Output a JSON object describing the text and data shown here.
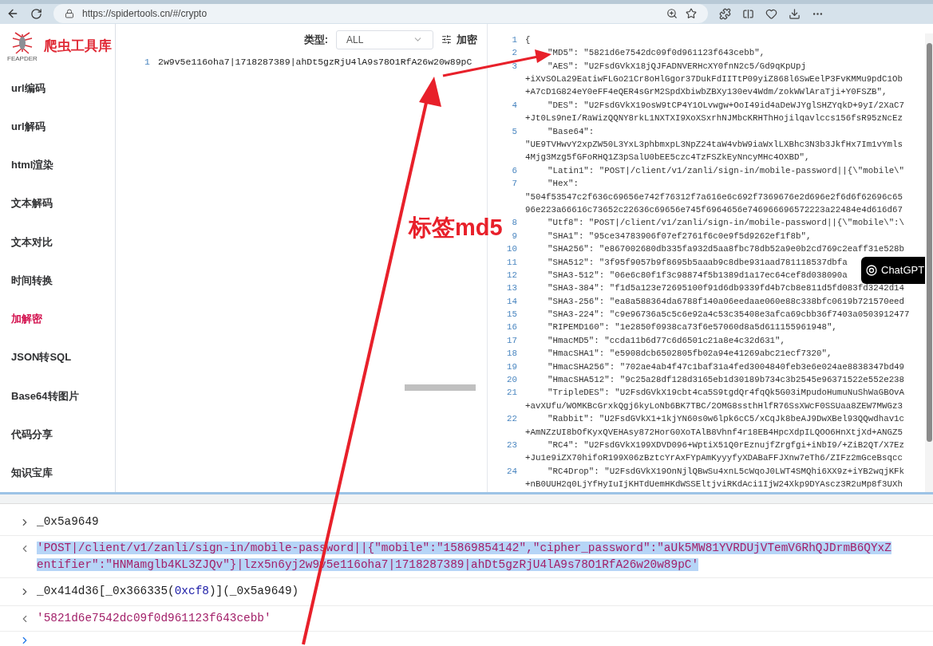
{
  "browser": {
    "url": "https://spidertools.cn/#/crypto"
  },
  "sidebar": {
    "logo_caption": "FEAPDER",
    "title": "爬虫工具库",
    "items": [
      {
        "label": "url编码",
        "selected": false
      },
      {
        "label": "url解码",
        "selected": false
      },
      {
        "label": "html渲染",
        "selected": false
      },
      {
        "label": "文本解码",
        "selected": false
      },
      {
        "label": "文本对比",
        "selected": false
      },
      {
        "label": "时间转换",
        "selected": false
      },
      {
        "label": "加解密",
        "selected": true
      },
      {
        "label": "JSON转SQL",
        "selected": false
      },
      {
        "label": "Base64转图片",
        "selected": false
      },
      {
        "label": "代码分享",
        "selected": false
      },
      {
        "label": "知识宝库",
        "selected": false
      }
    ]
  },
  "editor": {
    "type_label": "类型:",
    "type_value": "ALL",
    "action": "加密",
    "lines": [
      {
        "number": "1",
        "text": "2w9v5e116oha7|1718287389|ahDt5gzRjU4lA9s78O1RfA26w20w89pC"
      }
    ]
  },
  "output": {
    "lines": [
      {
        "kind": "brace",
        "number": "1",
        "text": "{"
      },
      {
        "kind": "entry",
        "number": "2",
        "text": "\"MD5\": \"5821d6e7542dc09f0d961123f643cebb\","
      },
      {
        "kind": "entry",
        "number": "3",
        "text": "\"AES\": \"U2FsdGVkX18jQJFADNVERHcXY0fnN2c5/Gd9qKpUpj"
      },
      {
        "kind": "wrap",
        "text": "+iXvSOLa29EatiwFLGo21Cr8oHlGgor37DukFdIITtP09yiZ868l6SwEelP3FvKMMu9pdC1Ob"
      },
      {
        "kind": "wrap",
        "text": "+A7cD1G824eY0eFF4eQER4sGrM2SpdXbiwbZBXy130ev4Wdm/zokWWlAraTji+Y0FSZB\","
      },
      {
        "kind": "entry",
        "number": "4",
        "text": "\"DES\": \"U2FsdGVkX19osW9tCP4Y1OLvwgw+OoI49id4aDeWJYglSHZYqkD+9yI/2XaC7"
      },
      {
        "kind": "wrap",
        "text": "+Jt0Ls9neI/RaWizQQNY8rkL1NXTXI9XoXSxrhNJMbcKRHThHojilqavlccs156fsR95zNcEz"
      },
      {
        "kind": "entry",
        "number": "5",
        "text": "\"Base64\":"
      },
      {
        "kind": "wrap",
        "text": "\"UE9TVHwvY2xpZW50L3YxL3phbmxpL3NpZ24taW4vbW9iaWxlLXBhc3N3b3JkfHx7Im1vYmls"
      },
      {
        "kind": "wrap",
        "text": "4Mjg3Mzg5fGFoRHQ1Z3pSalU0bEE5czc4TzFSZkEyNncyMHc4OXBD\","
      },
      {
        "kind": "entry",
        "number": "6",
        "text": "\"Latin1\": \"POST|/client/v1/zanli/sign-in/mobile-password||{\\\"mobile\\\""
      },
      {
        "kind": "entry",
        "number": "7",
        "text": "\"Hex\":"
      },
      {
        "kind": "wrap",
        "text": "\"504f53547c2f636c69656e742f76312f7a616e6c692f7369676e2d696e2f6d6f62696c65"
      },
      {
        "kind": "wrap",
        "text": "96e223a66616c73652c22636c69656e745f6964656e746966696572223a22484e4d616d67"
      },
      {
        "kind": "entry",
        "number": "8",
        "text": "\"Utf8\": \"POST|/client/v1/zanli/sign-in/mobile-password||{\\\"mobile\\\":\\"
      },
      {
        "kind": "entry",
        "number": "9",
        "text": "\"SHA1\": \"95ce34783906f07ef2761f6c0e9f5d9262ef1f8b\","
      },
      {
        "kind": "entry",
        "number": "10",
        "text": "\"SHA256\": \"e867002680db335fa932d5aa8fbc78db52a9e0b2cd769c2eaff31e528b"
      },
      {
        "kind": "entry",
        "number": "11",
        "text": "\"SHA512\": \"3f95f9057b9f8695b5aaab9c8dbe931aad781118537dbfa"
      },
      {
        "kind": "entry",
        "number": "12",
        "text": "\"SHA3-512\": \"06e6c80f1f3c98874f5b1389d1a17ec64cef8d038090a"
      },
      {
        "kind": "entry",
        "number": "13",
        "text": "\"SHA3-384\": \"f1d5a123e72695100f91d6db9339fd4b7cb8e811d5fd083fd3242d14"
      },
      {
        "kind": "entry",
        "number": "14",
        "text": "\"SHA3-256\": \"ea8a588364da6788f140a06eedaae060e88c338bfc0619b721570eed"
      },
      {
        "kind": "entry",
        "number": "15",
        "text": "\"SHA3-224\": \"c9e96736a5c5c6e92a4c53c35408e3afca69cbb36f7403a0503912477"
      },
      {
        "kind": "entry",
        "number": "16",
        "text": "\"RIPEMD160\": \"1e2850f0938ca73f6e57060d8a5d611155961948\","
      },
      {
        "kind": "entry",
        "number": "17",
        "text": "\"HmacMD5\": \"ccda11b6d77c6d6501c21a8e4c32d631\","
      },
      {
        "kind": "entry",
        "number": "18",
        "text": "\"HmacSHA1\": \"e5908dcb6502805fb02a94e41269abc21ecf7320\","
      },
      {
        "kind": "entry",
        "number": "19",
        "text": "\"HmacSHA256\": \"702ae4ab4f47c1baf31a4fed3004840feb3e6e024ae8838347bd49"
      },
      {
        "kind": "entry",
        "number": "20",
        "text": "\"HmacSHA512\": \"9c25a28df128d3165eb1d30189b734c3b2545e96371522e552e238"
      },
      {
        "kind": "entry",
        "number": "21",
        "text": "\"TripleDES\": \"U2FsdGVkX19cbt4ca5S9tgdQr4fqQk5G03iMpudoHumuNuShWaGBOvA"
      },
      {
        "kind": "wrap",
        "text": "+avXUfu/WOMKBcGrxkQgj6kyLoNb6BK7TBC/2OMG8ssthHlfR76SsXWcF0SSUaa8ZEW7MWGz3"
      },
      {
        "kind": "entry",
        "number": "22",
        "text": "\"Rabbit\": \"U2FsdGVkX1+1kjYN60s0w6lpk6cC5/xCqJk8beAJ9DwXBel93QQwdhav1c"
      },
      {
        "kind": "wrap",
        "text": "+AmNZzUI8bOfKyxQVEHAsy872HorG0XoTAlB8Vhnf4r18EB4HpcXdpILQOO6HnXtjXd+ANGZ5"
      },
      {
        "kind": "entry",
        "number": "23",
        "text": "\"RC4\": \"U2FsdGVkX199XDVD096+WptiX51Q0rEznujfZrgfgi+iNbI9/+ZiB2QT/X7Ez"
      },
      {
        "kind": "wrap",
        "text": "+Ju1e9iZX70hifoR199X06zBztcYrAxFYpAmKyyyfyXDABaFFJXnw7eTh6/ZIFz2mGceBsqcc"
      },
      {
        "kind": "entry",
        "number": "24",
        "text": "\"RC4Drop\": \"U2FsdGVkX19OnNjlQBwSu4xnL5cWqoJ0LWT4SMQhi6XX9z+iYB2wqjKFk"
      },
      {
        "kind": "wrap",
        "text": "+nB0UUH2q0LjYfHyIuIjKHTdUemHKdWSSEltjviRKdAci1IjW24Xkp9DYAscz3R2uMp8f3UXh"
      }
    ]
  },
  "chatgpt_badge": {
    "label": "ChatGPT"
  },
  "console": {
    "entries": [
      {
        "kind": "input",
        "segments": [
          {
            "kind": "plain",
            "text": "_0x5a9649"
          }
        ]
      },
      {
        "kind": "output",
        "selected": true,
        "lines": [
          "'POST|/client/v1/zanli/sign-in/mobile-password||{\"mobile\":\"15869854142\",\"cipher_password\":\"aUk5MW81YVRDUjVTemV6RhQJDrmB6QYxZ",
          "entifier\":\"HNMamglb4KL3ZJQv\"}|lzx5n6yj2w9v5e116oha7|1718287389|ahDt5gzRjU4lA9s78O1RfA26w20w89pC'"
        ]
      },
      {
        "kind": "input",
        "segments": [
          {
            "kind": "plain",
            "text": "_0x414d36[_0x366335("
          },
          {
            "kind": "number",
            "text": "0xcf8"
          },
          {
            "kind": "plain",
            "text": ")](_0x5a9649)"
          }
        ]
      },
      {
        "kind": "output",
        "selected": false,
        "lines": [
          "'5821d6e7542dc09f0d961123f643cebb'"
        ]
      },
      {
        "kind": "prompt"
      }
    ]
  },
  "annotation": {
    "label": "标签md5"
  }
}
